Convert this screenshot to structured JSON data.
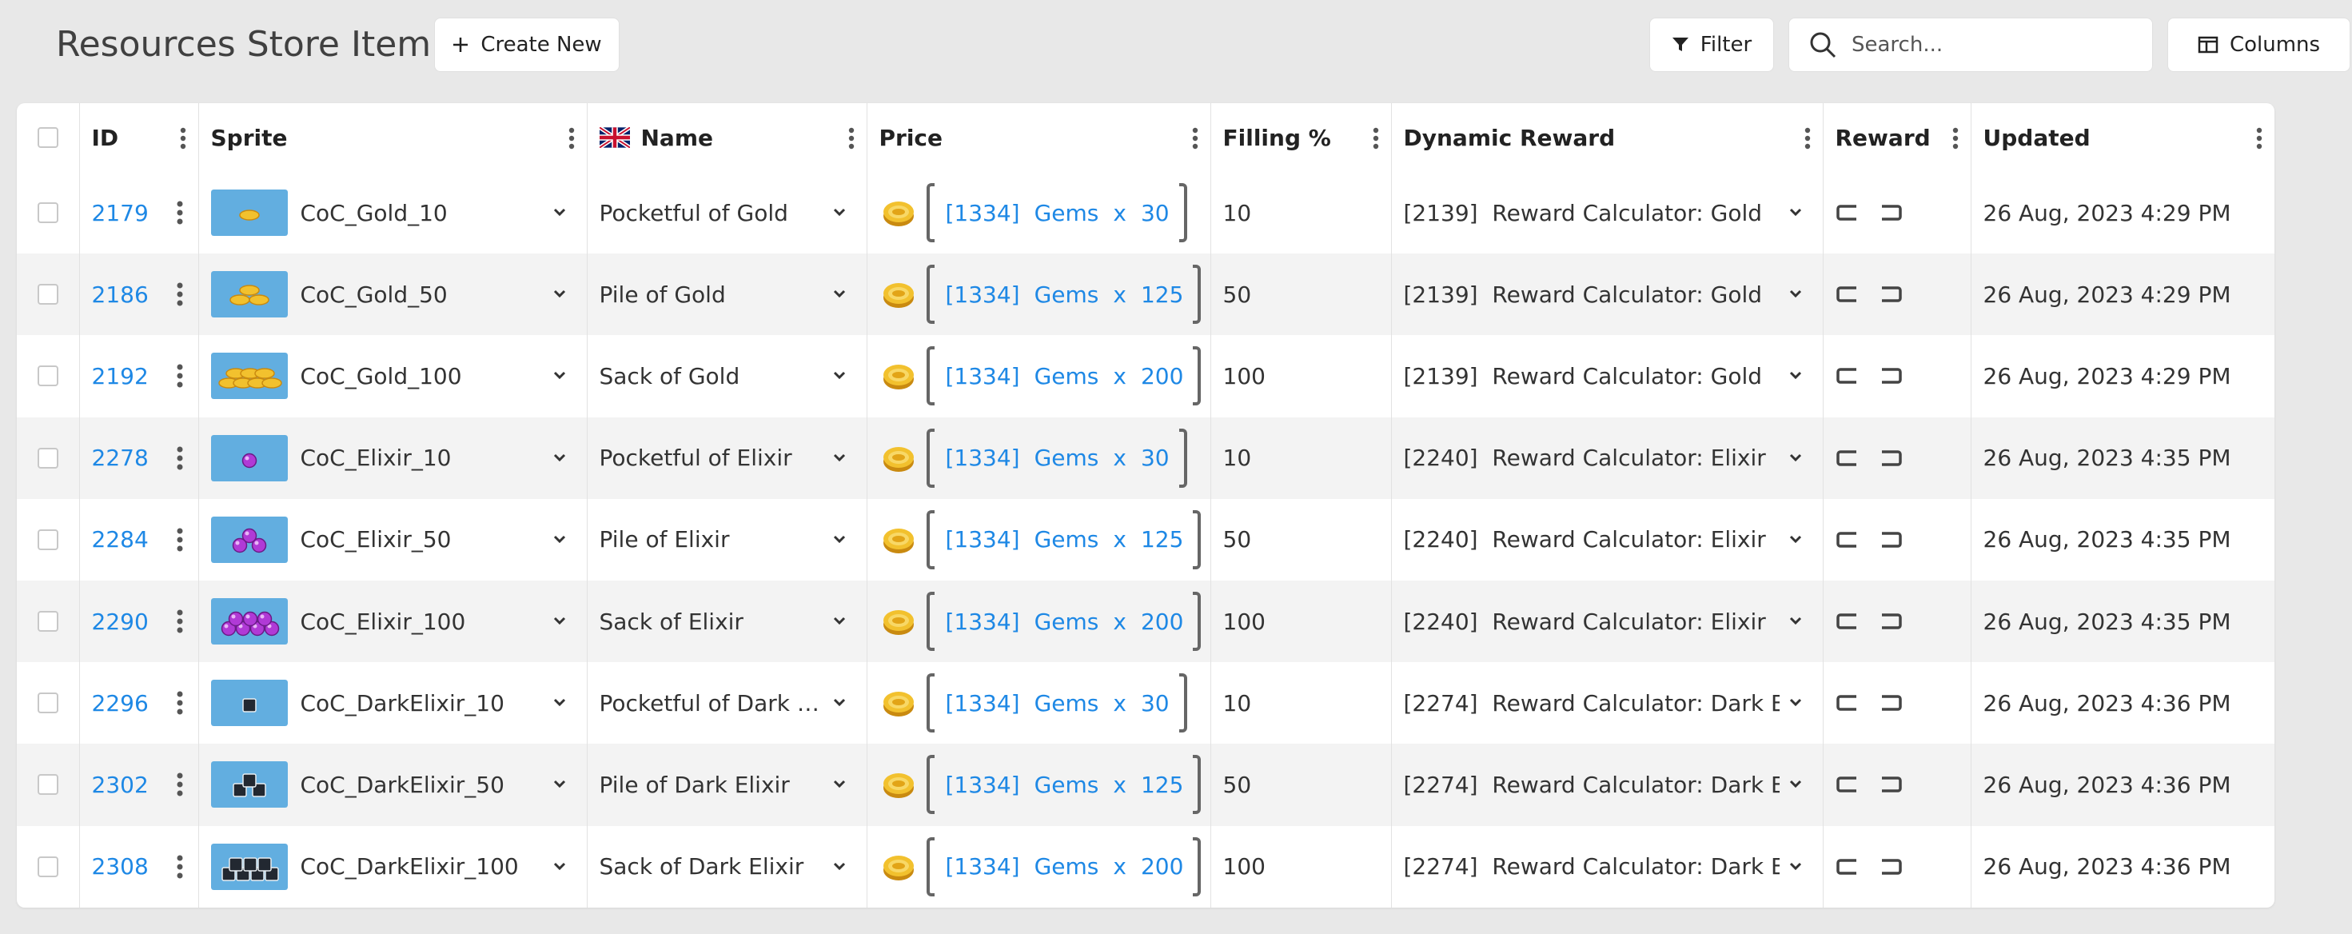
{
  "header": {
    "title": "Resources Store Item",
    "create_label": "Create New",
    "filter_label": "Filter",
    "search_placeholder": "Search...",
    "columns_label": "Columns"
  },
  "columns": {
    "id": "ID",
    "sprite": "Sprite",
    "name": "Name",
    "price": "Price",
    "filling": "Filling %",
    "dynamic_reward": "Dynamic Reward",
    "reward": "Reward",
    "updated": "Updated"
  },
  "rows": [
    {
      "id": "2179",
      "sprite": "CoC_Gold_10",
      "sprite_kind": "gold",
      "sprite_count": 1,
      "name": "Pocketful of Gold",
      "price_ref": "[1334]",
      "price_item": "Gems",
      "price_x": "x",
      "price_qty": "30",
      "filling": "10",
      "dyn_ref": "[2139]",
      "dyn_name": "Reward Calculator: Gold",
      "updated": "26 Aug, 2023 4:29 PM"
    },
    {
      "id": "2186",
      "sprite": "CoC_Gold_50",
      "sprite_kind": "gold",
      "sprite_count": 2,
      "name": "Pile of Gold",
      "price_ref": "[1334]",
      "price_item": "Gems",
      "price_x": "x",
      "price_qty": "125",
      "filling": "50",
      "dyn_ref": "[2139]",
      "dyn_name": "Reward Calculator: Gold",
      "updated": "26 Aug, 2023 4:29 PM"
    },
    {
      "id": "2192",
      "sprite": "CoC_Gold_100",
      "sprite_kind": "gold",
      "sprite_count": 3,
      "name": "Sack of Gold",
      "price_ref": "[1334]",
      "price_item": "Gems",
      "price_x": "x",
      "price_qty": "200",
      "filling": "100",
      "dyn_ref": "[2139]",
      "dyn_name": "Reward Calculator: Gold",
      "updated": "26 Aug, 2023 4:29 PM"
    },
    {
      "id": "2278",
      "sprite": "CoC_Elixir_10",
      "sprite_kind": "elixir",
      "sprite_count": 1,
      "name": "Pocketful of Elixir",
      "price_ref": "[1334]",
      "price_item": "Gems",
      "price_x": "x",
      "price_qty": "30",
      "filling": "10",
      "dyn_ref": "[2240]",
      "dyn_name": "Reward Calculator: Elixir",
      "updated": "26 Aug, 2023 4:35 PM"
    },
    {
      "id": "2284",
      "sprite": "CoC_Elixir_50",
      "sprite_kind": "elixir",
      "sprite_count": 2,
      "name": "Pile of Elixir",
      "price_ref": "[1334]",
      "price_item": "Gems",
      "price_x": "x",
      "price_qty": "125",
      "filling": "50",
      "dyn_ref": "[2240]",
      "dyn_name": "Reward Calculator: Elixir",
      "updated": "26 Aug, 2023 4:35 PM"
    },
    {
      "id": "2290",
      "sprite": "CoC_Elixir_100",
      "sprite_kind": "elixir",
      "sprite_count": 3,
      "name": "Sack of Elixir",
      "price_ref": "[1334]",
      "price_item": "Gems",
      "price_x": "x",
      "price_qty": "200",
      "filling": "100",
      "dyn_ref": "[2240]",
      "dyn_name": "Reward Calculator: Elixir",
      "updated": "26 Aug, 2023 4:35 PM"
    },
    {
      "id": "2296",
      "sprite": "CoC_DarkElixir_10",
      "sprite_kind": "dark",
      "sprite_count": 1,
      "name": "Pocketful of Dark E...",
      "price_ref": "[1334]",
      "price_item": "Gems",
      "price_x": "x",
      "price_qty": "30",
      "filling": "10",
      "dyn_ref": "[2274]",
      "dyn_name": "Reward Calculator: Dark Elixir",
      "updated": "26 Aug, 2023 4:36 PM"
    },
    {
      "id": "2302",
      "sprite": "CoC_DarkElixir_50",
      "sprite_kind": "dark",
      "sprite_count": 2,
      "name": "Pile of Dark Elixir",
      "price_ref": "[1334]",
      "price_item": "Gems",
      "price_x": "x",
      "price_qty": "125",
      "filling": "50",
      "dyn_ref": "[2274]",
      "dyn_name": "Reward Calculator: Dark Elixir",
      "updated": "26 Aug, 2023 4:36 PM"
    },
    {
      "id": "2308",
      "sprite": "CoC_DarkElixir_100",
      "sprite_kind": "dark",
      "sprite_count": 3,
      "name": "Sack of Dark Elixir",
      "price_ref": "[1334]",
      "price_item": "Gems",
      "price_x": "x",
      "price_qty": "200",
      "filling": "100",
      "dyn_ref": "[2274]",
      "dyn_name": "Reward Calculator: Dark Elixir",
      "updated": "26 Aug, 2023 4:36 PM"
    }
  ],
  "icons": {
    "create": "plus-icon",
    "filter": "funnel-icon",
    "search": "magnifier-icon",
    "columns": "columns-icon",
    "name_flag": "uk-flag-icon",
    "row_menu": "kebab-icon",
    "expand": "chevron-down-icon",
    "price_currency": "gold-coin-icon",
    "reward_left": "bracket-left-icon",
    "reward_right": "bracket-right-icon"
  },
  "colors": {
    "link": "#1e88e5",
    "page_bg": "#e8e8e8",
    "row_alt": "#f3f3f3",
    "gold": "#f2c12e",
    "elixir": "#b03ad6",
    "dark_elixir": "#222831",
    "sprite_bg": "#62aee0"
  }
}
